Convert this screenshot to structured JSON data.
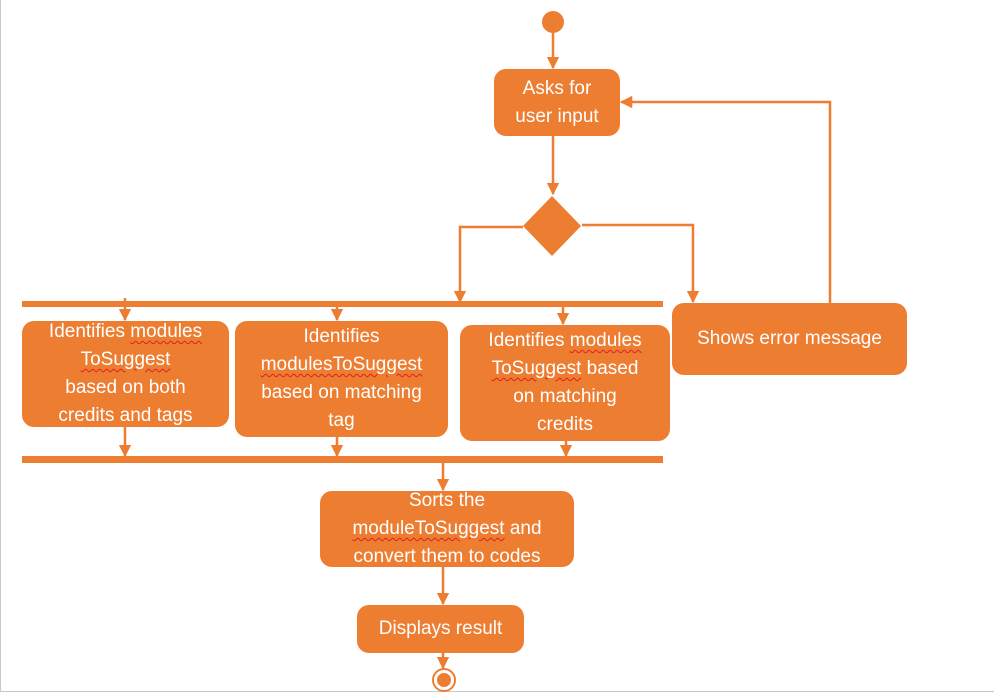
{
  "diagram": {
    "type": "uml-activity",
    "colors": {
      "accent": "#ed7d31",
      "text": "#ffffff",
      "background": "#ffffff",
      "frame": "#c8c8c8",
      "spellcheck": "#e02020"
    },
    "start": {
      "label": ""
    },
    "end": {
      "label": ""
    },
    "nodes": {
      "ask_input": {
        "lines": [
          "Asks for",
          "user input"
        ]
      },
      "error": {
        "lines": [
          "Shows error message"
        ]
      },
      "both": {
        "lines": [
          "Identifies modules",
          "ToSuggest",
          "based on both",
          "credits and tags"
        ]
      },
      "tag": {
        "lines": [
          "Identifies",
          "modulesToSuggest",
          "based on matching",
          "tag"
        ]
      },
      "credits": {
        "lines": [
          "Identifies modules",
          "ToSuggest based",
          "on matching",
          "credits"
        ]
      },
      "sort": {
        "lines": [
          "Sorts the",
          "moduleToSuggest and",
          "convert them to codes"
        ]
      },
      "display": {
        "lines": [
          "Displays result"
        ]
      }
    },
    "spellcheck_words": [
      "modules",
      "ToSuggest",
      "modulesToSuggest",
      "moduleToSuggest"
    ],
    "edges": [
      {
        "from": "start",
        "to": "ask_input"
      },
      {
        "from": "ask_input",
        "to": "decision"
      },
      {
        "from": "decision",
        "to": "fork",
        "direction": "left"
      },
      {
        "from": "decision",
        "to": "error",
        "direction": "right"
      },
      {
        "from": "error",
        "to": "ask_input"
      },
      {
        "from": "fork",
        "to": "both"
      },
      {
        "from": "fork",
        "to": "tag"
      },
      {
        "from": "fork",
        "to": "credits"
      },
      {
        "from": "both",
        "to": "join"
      },
      {
        "from": "tag",
        "to": "join"
      },
      {
        "from": "credits",
        "to": "join"
      },
      {
        "from": "join",
        "to": "sort"
      },
      {
        "from": "sort",
        "to": "display"
      },
      {
        "from": "display",
        "to": "end"
      }
    ]
  }
}
